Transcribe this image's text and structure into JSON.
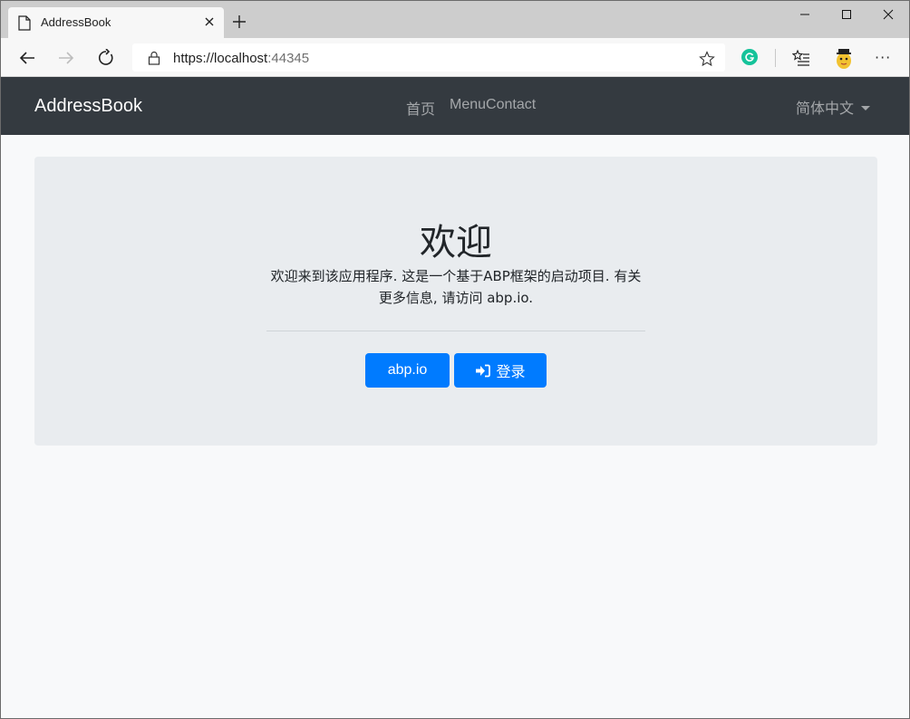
{
  "browser": {
    "tab_title": "AddressBook",
    "url_host": "https://localhost",
    "url_port": ":44345"
  },
  "app": {
    "brand": "AddressBook",
    "menu": [
      {
        "label": "首页"
      },
      {
        "label": "MenuContact"
      }
    ],
    "language": "简体中文"
  },
  "jumbotron": {
    "title": "欢迎",
    "text": "欢迎来到该应用程序. 这是一个基于ABP框架的启动项目. 有关更多信息, 请访问 abp.io.",
    "button_abp": "abp.io",
    "button_login": "登录"
  },
  "colors": {
    "navbar_bg": "#343a40",
    "primary": "#007bff",
    "jumbotron_bg": "#e9ecef",
    "page_bg": "#f8f9fa"
  },
  "icons": [
    "page-icon",
    "close-icon",
    "plus-icon",
    "minimize-icon",
    "maximize-icon",
    "back-arrow-icon",
    "forward-arrow-icon",
    "refresh-icon",
    "lock-icon",
    "star-icon",
    "grammarly-icon",
    "favorites-icon",
    "profile-avatar-icon",
    "more-icon",
    "sign-in-icon"
  ]
}
